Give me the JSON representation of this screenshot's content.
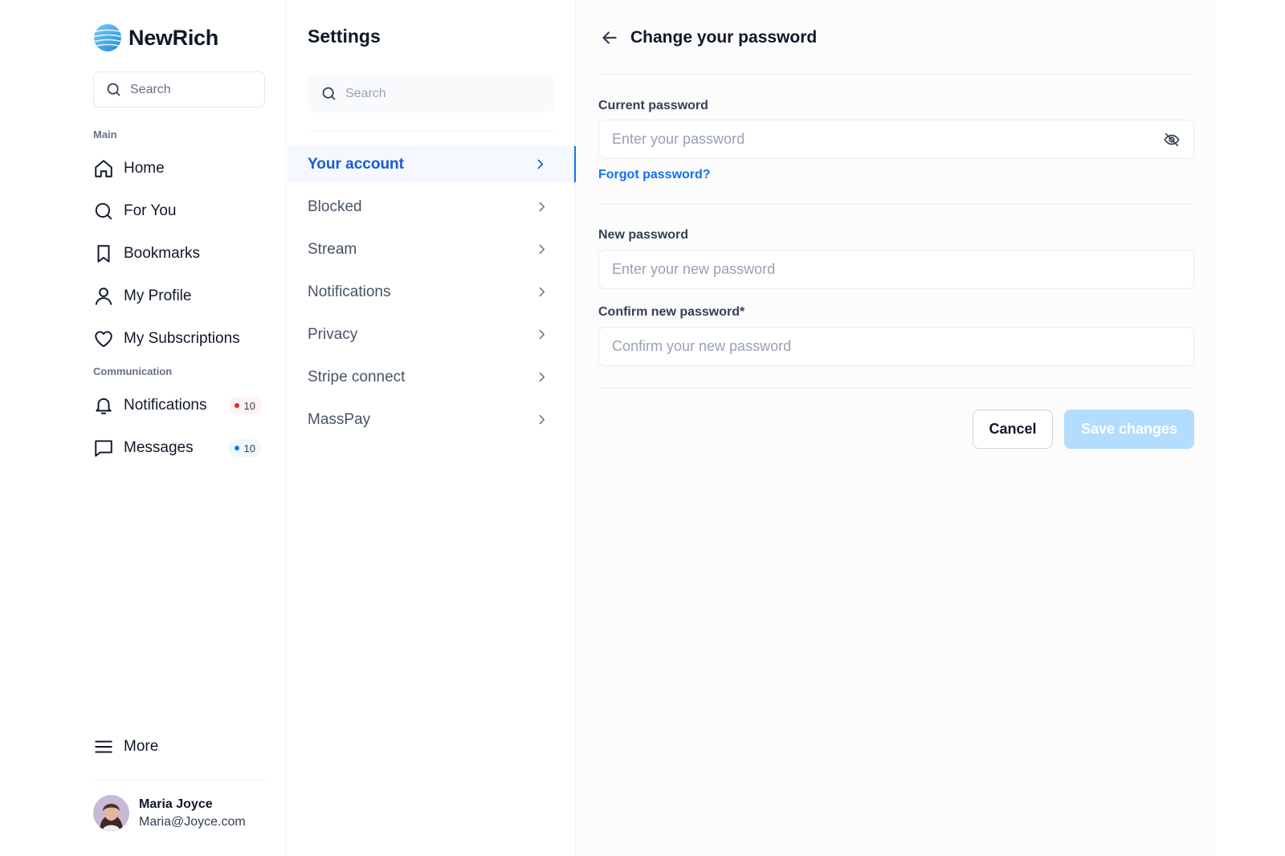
{
  "brand": {
    "name": "NewRich",
    "logo_icon": "globe-logo-icon",
    "accent": "#1570ef"
  },
  "nav": {
    "search_placeholder": "Search",
    "main_label": "Main",
    "main_items": [
      {
        "label": "Home",
        "icon": "home-icon"
      },
      {
        "label": "For You",
        "icon": "search-icon"
      },
      {
        "label": "Bookmarks",
        "icon": "bookmark-icon"
      },
      {
        "label": "My Profile",
        "icon": "user-icon"
      },
      {
        "label": "My Subscriptions",
        "icon": "heart-icon"
      }
    ],
    "communication_label": "Communication",
    "communication_items": [
      {
        "label": "Notifications",
        "icon": "bell-icon",
        "badge": "10",
        "badge_color": "#d92d20"
      },
      {
        "label": "Messages",
        "icon": "message-icon",
        "badge": "10",
        "badge_color": "#1570ef"
      }
    ],
    "more_label": "More",
    "user": {
      "name": "Maria Joyce",
      "email": "Maria@Joyce.com"
    }
  },
  "settings": {
    "title": "Settings",
    "search_placeholder": "Search",
    "items": [
      {
        "label": "Your account",
        "active": true
      },
      {
        "label": "Blocked",
        "active": false
      },
      {
        "label": "Stream",
        "active": false
      },
      {
        "label": "Notifications",
        "active": false
      },
      {
        "label": "Privacy",
        "active": false
      },
      {
        "label": "Stripe connect",
        "active": false
      },
      {
        "label": "MassPay",
        "active": false
      }
    ]
  },
  "main": {
    "title": "Change your password",
    "current_password": {
      "label": "Current password",
      "value": "",
      "placeholder": "Enter your password"
    },
    "forgot_link": "Forgot password?",
    "new_password": {
      "label": "New password",
      "value": "",
      "placeholder": "Enter your new password"
    },
    "confirm_password": {
      "label": "Confirm new password*",
      "value": "",
      "placeholder": "Confirm your new password"
    },
    "cancel_label": "Cancel",
    "save_label": "Save changes"
  }
}
